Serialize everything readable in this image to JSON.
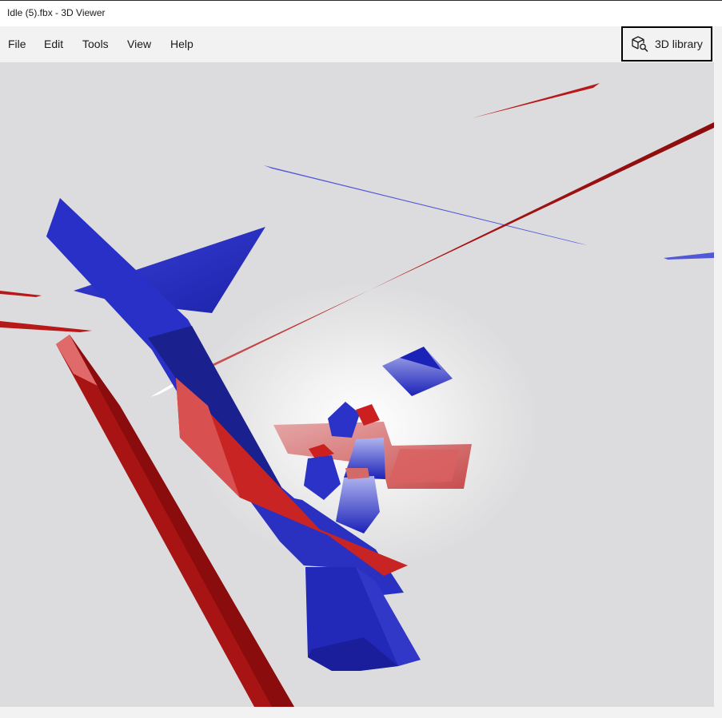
{
  "window": {
    "title": "Idle (5).fbx - 3D Viewer"
  },
  "menu": {
    "items": [
      {
        "label": "File"
      },
      {
        "label": "Edit"
      },
      {
        "label": "Tools"
      },
      {
        "label": "View"
      },
      {
        "label": "Help"
      }
    ]
  },
  "toolbar": {
    "library_label": "3D library",
    "library_icon": "cube-search-icon"
  },
  "viewport": {
    "model_colors": {
      "primary_blue": "#2a32c8",
      "primary_red": "#c41e1e"
    }
  }
}
